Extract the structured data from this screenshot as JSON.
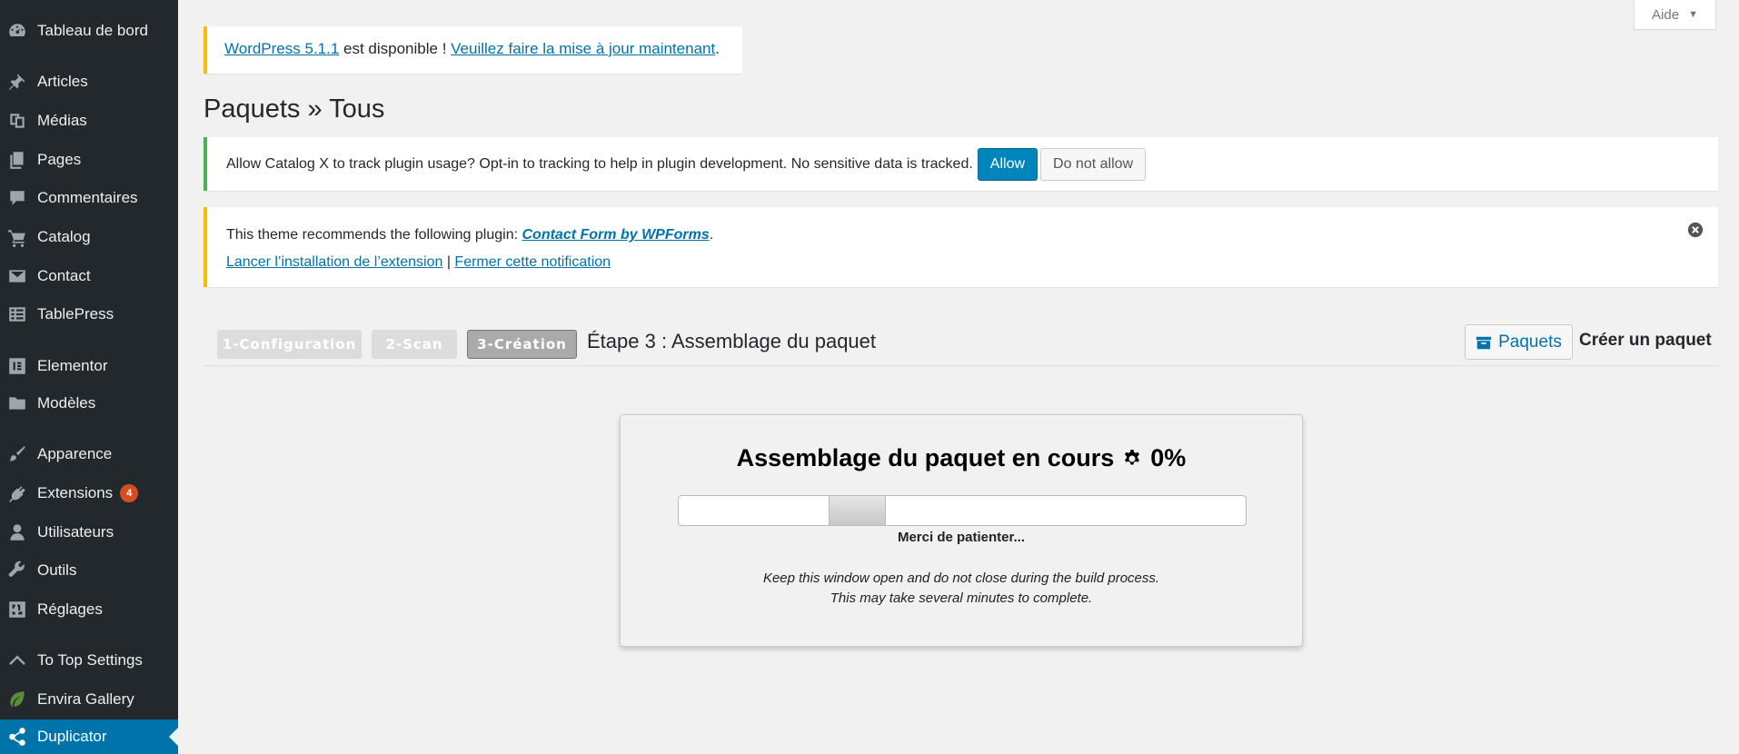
{
  "sidebar": {
    "items": [
      {
        "label": "Tableau de bord",
        "icon": "dashboard-icon"
      },
      {
        "label": "Articles",
        "icon": "pushpin-icon"
      },
      {
        "label": "Médias",
        "icon": "media-icon"
      },
      {
        "label": "Pages",
        "icon": "pages-icon"
      },
      {
        "label": "Commentaires",
        "icon": "comment-icon"
      },
      {
        "label": "Catalog",
        "icon": "cart-icon"
      },
      {
        "label": "Contact",
        "icon": "envelope-icon"
      },
      {
        "label": "TablePress",
        "icon": "table-icon"
      },
      {
        "label": "Elementor",
        "icon": "elementor-icon"
      },
      {
        "label": "Modèles",
        "icon": "folder-icon"
      },
      {
        "label": "Apparence",
        "icon": "paintbrush-icon"
      },
      {
        "label": "Extensions",
        "icon": "plugin-icon",
        "badge": "4"
      },
      {
        "label": "Utilisateurs",
        "icon": "user-icon"
      },
      {
        "label": "Outils",
        "icon": "wrench-icon"
      },
      {
        "label": "Réglages",
        "icon": "settings-icon"
      },
      {
        "label": "To Top Settings",
        "icon": "chevron-up-icon"
      },
      {
        "label": "Envira Gallery",
        "icon": "leaf-icon"
      },
      {
        "label": "Duplicator",
        "icon": "share-icon",
        "active": true
      }
    ]
  },
  "help_tab": {
    "label": "Aide"
  },
  "update_notice": {
    "link1": "WordPress 5.1.1",
    "text": " est disponible ! ",
    "link2": "Veuillez faire la mise à jour maintenant",
    "end": "."
  },
  "page_title": "Paquets » Tous",
  "tracking_notice": {
    "text": "Allow Catalog X to track plugin usage? Opt-in to tracking to help in plugin development. No sensitive data is tracked.",
    "allow_label": "Allow",
    "deny_label": "Do not allow"
  },
  "theme_notice": {
    "text": "This theme recommends the following plugin: ",
    "plugin_link": "Contact Form by WPForms",
    "period": ".",
    "install_link": "Lancer l’installation de l’extension",
    "separator": " | ",
    "dismiss_link": "Fermer cette notification"
  },
  "steps": {
    "step1": "1-Configuration",
    "step2": "2-Scan",
    "step3": "3-Création",
    "label": "Étape 3 : Assemblage du paquet"
  },
  "toolbar": {
    "packages_label": "Paquets",
    "create_label": "Créer un paquet"
  },
  "progress": {
    "title": "Assemblage du paquet en cours",
    "percent": "0%",
    "wait_text": "Merci de patienter...",
    "hint1": "Keep this window open and do not close during the build process.",
    "hint2": "This may take several minutes to complete."
  },
  "colors": {
    "sidebar_bg": "#23282d",
    "active_menu": "#0073aa",
    "primary_button": "#0085ba",
    "badge": "#d54e21",
    "notice_warning": "#ffb900",
    "notice_success": "#46b450"
  }
}
